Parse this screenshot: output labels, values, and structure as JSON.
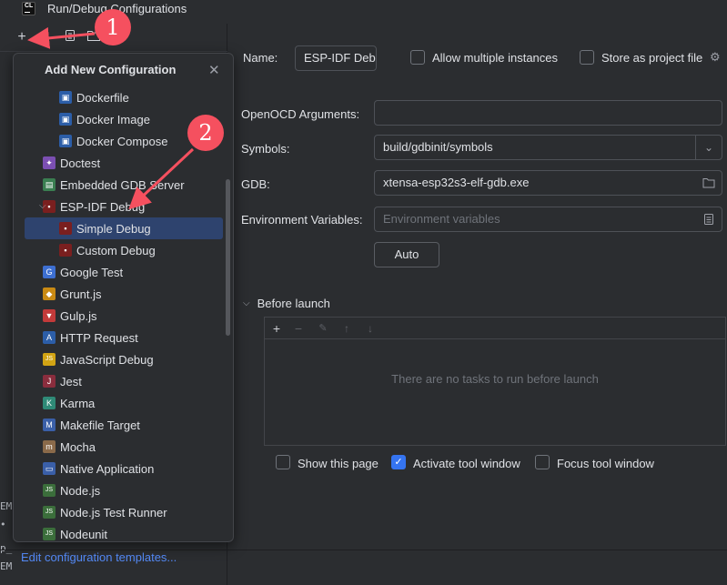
{
  "window": {
    "title": "Run/Debug Configurations"
  },
  "left": {
    "toolbar": [
      "add-icon",
      "copy-icon",
      "folder-icon"
    ],
    "edit_templates": "Edit configuration templates...",
    "terminal_lines": [
      "EM",
      "•",
      "p_",
      "EM"
    ]
  },
  "popup": {
    "title": "Add New Configuration",
    "items": [
      {
        "label": "Dockerfile",
        "icon": "docker-icon",
        "indent": 2
      },
      {
        "label": "Docker Image",
        "icon": "docker-icon",
        "indent": 2
      },
      {
        "label": "Docker Compose",
        "icon": "docker-icon",
        "indent": 2
      },
      {
        "label": "Doctest",
        "icon": "doctest-icon",
        "indent": 1
      },
      {
        "label": "Embedded GDB Server",
        "icon": "embedded-gdb-icon",
        "indent": 1
      },
      {
        "label": "ESP-IDF Debug",
        "icon": "esp-idf-icon",
        "indent": 1,
        "expanded": true
      },
      {
        "label": "Simple Debug",
        "icon": "esp-idf-icon",
        "indent": 2,
        "selected": true
      },
      {
        "label": "Custom Debug",
        "icon": "esp-idf-icon",
        "indent": 2
      },
      {
        "label": "Google Test",
        "icon": "google-test-icon",
        "indent": 1
      },
      {
        "label": "Grunt.js",
        "icon": "grunt-icon",
        "indent": 1
      },
      {
        "label": "Gulp.js",
        "icon": "gulp-icon",
        "indent": 1
      },
      {
        "label": "HTTP Request",
        "icon": "http-icon",
        "indent": 1
      },
      {
        "label": "JavaScript Debug",
        "icon": "js-icon",
        "indent": 1
      },
      {
        "label": "Jest",
        "icon": "jest-icon",
        "indent": 1
      },
      {
        "label": "Karma",
        "icon": "karma-icon",
        "indent": 1
      },
      {
        "label": "Makefile Target",
        "icon": "makefile-icon",
        "indent": 1
      },
      {
        "label": "Mocha",
        "icon": "mocha-icon",
        "indent": 1
      },
      {
        "label": "Native Application",
        "icon": "native-app-icon",
        "indent": 1
      },
      {
        "label": "Node.js",
        "icon": "nodejs-icon",
        "indent": 1
      },
      {
        "label": "Node.js Test Runner",
        "icon": "nodejs-icon",
        "indent": 1
      },
      {
        "label": "Nodeunit",
        "icon": "nodejs-icon",
        "indent": 1
      }
    ]
  },
  "form": {
    "name_label": "Name:",
    "name_value": "ESP-IDF Debug",
    "allow_multiple": "Allow multiple instances",
    "store_as_file": "Store as project file",
    "openocd_label": "OpenOCD Arguments:",
    "openocd_value": "",
    "symbols_label": "Symbols:",
    "symbols_value": "build/gdbinit/symbols",
    "gdb_label": "GDB:",
    "gdb_value": "xtensa-esp32s3-elf-gdb.exe",
    "env_label": "Environment Variables:",
    "env_placeholder": "Environment variables",
    "auto_button": "Auto",
    "before_launch": "Before launch",
    "empty_tasks": "There are no tasks to run before launch",
    "show_page": "Show this page",
    "activate_tool": "Activate tool window",
    "focus_tool": "Focus tool window"
  },
  "annotations": {
    "badge1": "1",
    "badge2": "2",
    "color": "#f5505f"
  },
  "colors": {
    "accent": "#3574f0",
    "selection": "#2e436e",
    "link": "#548af7"
  }
}
